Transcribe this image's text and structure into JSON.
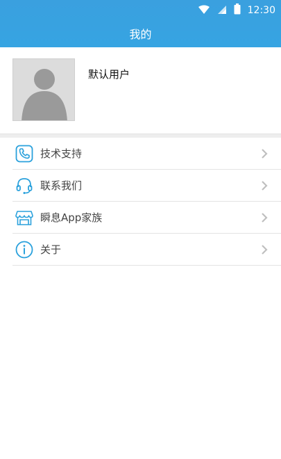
{
  "status_bar": {
    "time": "12:30",
    "icons": [
      "wifi-icon",
      "signal-icon",
      "battery-icon"
    ]
  },
  "header": {
    "title": "我的"
  },
  "profile": {
    "username": "默认用户",
    "avatar_icon": "default-avatar-icon"
  },
  "menu": {
    "items": [
      {
        "label": "技术支持",
        "icon": "phone-icon"
      },
      {
        "label": "联系我们",
        "icon": "headset-icon"
      },
      {
        "label": "瞬息App家族",
        "icon": "store-icon"
      },
      {
        "label": "关于",
        "icon": "info-icon"
      }
    ]
  },
  "colors": {
    "header": "#36a4e2",
    "icon_accent": "#2aa1dc",
    "chevron": "#bfbfbf"
  }
}
